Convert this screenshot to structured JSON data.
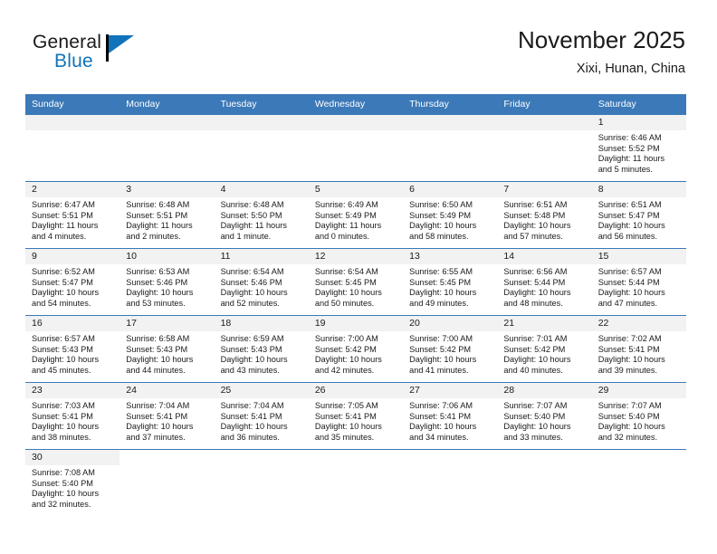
{
  "brand": {
    "name_part1": "General",
    "name_part2": "Blue",
    "logo_icon": "flag-triangle-icon"
  },
  "header": {
    "title": "November 2025",
    "subtitle": "Xixi, Hunan, China"
  },
  "colors": {
    "header_blue": "#3b79b8",
    "brand_blue": "#1273ba",
    "daynum_band": "#f2f2f2",
    "text": "#1a1a1a"
  },
  "labels": {
    "sunrise": "Sunrise:",
    "sunset": "Sunset:",
    "daylight": "Daylight:"
  },
  "weekdays": [
    "Sunday",
    "Monday",
    "Tuesday",
    "Wednesday",
    "Thursday",
    "Friday",
    "Saturday"
  ],
  "weeks": [
    [
      {
        "day": "",
        "blank": true
      },
      {
        "day": "",
        "blank": true
      },
      {
        "day": "",
        "blank": true
      },
      {
        "day": "",
        "blank": true
      },
      {
        "day": "",
        "blank": true
      },
      {
        "day": "",
        "blank": true
      },
      {
        "day": "1",
        "sunrise": "Sunrise: 6:46 AM",
        "sunset": "Sunset: 5:52 PM",
        "daylight1": "Daylight: 11 hours",
        "daylight2": "and 5 minutes."
      }
    ],
    [
      {
        "day": "2",
        "sunrise": "Sunrise: 6:47 AM",
        "sunset": "Sunset: 5:51 PM",
        "daylight1": "Daylight: 11 hours",
        "daylight2": "and 4 minutes."
      },
      {
        "day": "3",
        "sunrise": "Sunrise: 6:48 AM",
        "sunset": "Sunset: 5:51 PM",
        "daylight1": "Daylight: 11 hours",
        "daylight2": "and 2 minutes."
      },
      {
        "day": "4",
        "sunrise": "Sunrise: 6:48 AM",
        "sunset": "Sunset: 5:50 PM",
        "daylight1": "Daylight: 11 hours",
        "daylight2": "and 1 minute."
      },
      {
        "day": "5",
        "sunrise": "Sunrise: 6:49 AM",
        "sunset": "Sunset: 5:49 PM",
        "daylight1": "Daylight: 11 hours",
        "daylight2": "and 0 minutes."
      },
      {
        "day": "6",
        "sunrise": "Sunrise: 6:50 AM",
        "sunset": "Sunset: 5:49 PM",
        "daylight1": "Daylight: 10 hours",
        "daylight2": "and 58 minutes."
      },
      {
        "day": "7",
        "sunrise": "Sunrise: 6:51 AM",
        "sunset": "Sunset: 5:48 PM",
        "daylight1": "Daylight: 10 hours",
        "daylight2": "and 57 minutes."
      },
      {
        "day": "8",
        "sunrise": "Sunrise: 6:51 AM",
        "sunset": "Sunset: 5:47 PM",
        "daylight1": "Daylight: 10 hours",
        "daylight2": "and 56 minutes."
      }
    ],
    [
      {
        "day": "9",
        "sunrise": "Sunrise: 6:52 AM",
        "sunset": "Sunset: 5:47 PM",
        "daylight1": "Daylight: 10 hours",
        "daylight2": "and 54 minutes."
      },
      {
        "day": "10",
        "sunrise": "Sunrise: 6:53 AM",
        "sunset": "Sunset: 5:46 PM",
        "daylight1": "Daylight: 10 hours",
        "daylight2": "and 53 minutes."
      },
      {
        "day": "11",
        "sunrise": "Sunrise: 6:54 AM",
        "sunset": "Sunset: 5:46 PM",
        "daylight1": "Daylight: 10 hours",
        "daylight2": "and 52 minutes."
      },
      {
        "day": "12",
        "sunrise": "Sunrise: 6:54 AM",
        "sunset": "Sunset: 5:45 PM",
        "daylight1": "Daylight: 10 hours",
        "daylight2": "and 50 minutes."
      },
      {
        "day": "13",
        "sunrise": "Sunrise: 6:55 AM",
        "sunset": "Sunset: 5:45 PM",
        "daylight1": "Daylight: 10 hours",
        "daylight2": "and 49 minutes."
      },
      {
        "day": "14",
        "sunrise": "Sunrise: 6:56 AM",
        "sunset": "Sunset: 5:44 PM",
        "daylight1": "Daylight: 10 hours",
        "daylight2": "and 48 minutes."
      },
      {
        "day": "15",
        "sunrise": "Sunrise: 6:57 AM",
        "sunset": "Sunset: 5:44 PM",
        "daylight1": "Daylight: 10 hours",
        "daylight2": "and 47 minutes."
      }
    ],
    [
      {
        "day": "16",
        "sunrise": "Sunrise: 6:57 AM",
        "sunset": "Sunset: 5:43 PM",
        "daylight1": "Daylight: 10 hours",
        "daylight2": "and 45 minutes."
      },
      {
        "day": "17",
        "sunrise": "Sunrise: 6:58 AM",
        "sunset": "Sunset: 5:43 PM",
        "daylight1": "Daylight: 10 hours",
        "daylight2": "and 44 minutes."
      },
      {
        "day": "18",
        "sunrise": "Sunrise: 6:59 AM",
        "sunset": "Sunset: 5:43 PM",
        "daylight1": "Daylight: 10 hours",
        "daylight2": "and 43 minutes."
      },
      {
        "day": "19",
        "sunrise": "Sunrise: 7:00 AM",
        "sunset": "Sunset: 5:42 PM",
        "daylight1": "Daylight: 10 hours",
        "daylight2": "and 42 minutes."
      },
      {
        "day": "20",
        "sunrise": "Sunrise: 7:00 AM",
        "sunset": "Sunset: 5:42 PM",
        "daylight1": "Daylight: 10 hours",
        "daylight2": "and 41 minutes."
      },
      {
        "day": "21",
        "sunrise": "Sunrise: 7:01 AM",
        "sunset": "Sunset: 5:42 PM",
        "daylight1": "Daylight: 10 hours",
        "daylight2": "and 40 minutes."
      },
      {
        "day": "22",
        "sunrise": "Sunrise: 7:02 AM",
        "sunset": "Sunset: 5:41 PM",
        "daylight1": "Daylight: 10 hours",
        "daylight2": "and 39 minutes."
      }
    ],
    [
      {
        "day": "23",
        "sunrise": "Sunrise: 7:03 AM",
        "sunset": "Sunset: 5:41 PM",
        "daylight1": "Daylight: 10 hours",
        "daylight2": "and 38 minutes."
      },
      {
        "day": "24",
        "sunrise": "Sunrise: 7:04 AM",
        "sunset": "Sunset: 5:41 PM",
        "daylight1": "Daylight: 10 hours",
        "daylight2": "and 37 minutes."
      },
      {
        "day": "25",
        "sunrise": "Sunrise: 7:04 AM",
        "sunset": "Sunset: 5:41 PM",
        "daylight1": "Daylight: 10 hours",
        "daylight2": "and 36 minutes."
      },
      {
        "day": "26",
        "sunrise": "Sunrise: 7:05 AM",
        "sunset": "Sunset: 5:41 PM",
        "daylight1": "Daylight: 10 hours",
        "daylight2": "and 35 minutes."
      },
      {
        "day": "27",
        "sunrise": "Sunrise: 7:06 AM",
        "sunset": "Sunset: 5:41 PM",
        "daylight1": "Daylight: 10 hours",
        "daylight2": "and 34 minutes."
      },
      {
        "day": "28",
        "sunrise": "Sunrise: 7:07 AM",
        "sunset": "Sunset: 5:40 PM",
        "daylight1": "Daylight: 10 hours",
        "daylight2": "and 33 minutes."
      },
      {
        "day": "29",
        "sunrise": "Sunrise: 7:07 AM",
        "sunset": "Sunset: 5:40 PM",
        "daylight1": "Daylight: 10 hours",
        "daylight2": "and 32 minutes."
      }
    ],
    [
      {
        "day": "30",
        "sunrise": "Sunrise: 7:08 AM",
        "sunset": "Sunset: 5:40 PM",
        "daylight1": "Daylight: 10 hours",
        "daylight2": "and 32 minutes."
      },
      {
        "day": "",
        "nocell": true
      },
      {
        "day": "",
        "nocell": true
      },
      {
        "day": "",
        "nocell": true
      },
      {
        "day": "",
        "nocell": true
      },
      {
        "day": "",
        "nocell": true
      },
      {
        "day": "",
        "nocell": true
      }
    ]
  ]
}
